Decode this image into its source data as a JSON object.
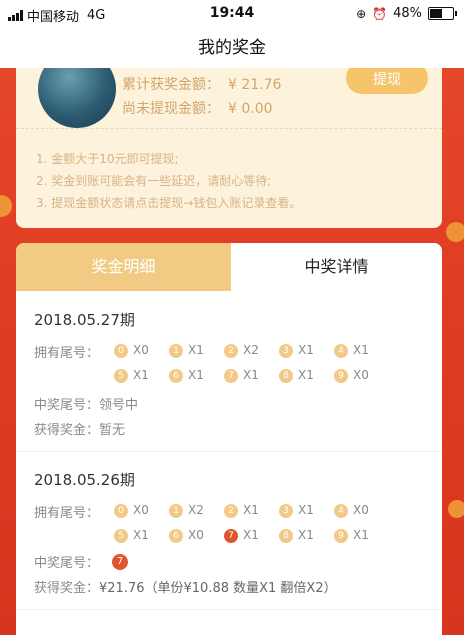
{
  "status_bar": {
    "carrier": "中国移动",
    "network": "4G",
    "time": "19:44",
    "battery": "48%"
  },
  "nav": {
    "title": "我的奖金"
  },
  "summary": {
    "total_label": "累计获奖金额：",
    "total_value": "¥ 21.76",
    "pending_label": "尚未提现金额：",
    "pending_value": "¥ 0.00",
    "withdraw_button": "提现",
    "notes": [
      "1. 金额大于10元即可提现;",
      "2. 奖金到账可能会有一些延迟，请耐心等待;",
      "3. 提现金额状态请点击提现→钱包入账记录查看。"
    ]
  },
  "tabs": [
    {
      "label": "奖金明细",
      "active": false
    },
    {
      "label": "中奖详情",
      "active": true
    }
  ],
  "records": [
    {
      "period": "2018.05.27期",
      "tails_label": "拥有尾号：",
      "tails": [
        {
          "digit": "0",
          "mult": "X0"
        },
        {
          "digit": "1",
          "mult": "X1"
        },
        {
          "digit": "2",
          "mult": "X2"
        },
        {
          "digit": "3",
          "mult": "X1"
        },
        {
          "digit": "4",
          "mult": "X1"
        },
        {
          "digit": "5",
          "mult": "X1"
        },
        {
          "digit": "6",
          "mult": "X1"
        },
        {
          "digit": "7",
          "mult": "X1"
        },
        {
          "digit": "8",
          "mult": "X1"
        },
        {
          "digit": "9",
          "mult": "X0"
        }
      ],
      "win_tail_label": "中奖尾号：",
      "win_tail": "领号中",
      "prize_label": "获得奖金：",
      "prize": "暂无"
    },
    {
      "period": "2018.05.26期",
      "tails_label": "拥有尾号：",
      "tails": [
        {
          "digit": "0",
          "mult": "X0"
        },
        {
          "digit": "1",
          "mult": "X2"
        },
        {
          "digit": "2",
          "mult": "X1"
        },
        {
          "digit": "3",
          "mult": "X1"
        },
        {
          "digit": "4",
          "mult": "X0"
        },
        {
          "digit": "5",
          "mult": "X1"
        },
        {
          "digit": "6",
          "mult": "X0"
        },
        {
          "digit": "7",
          "mult": "X1",
          "hit": true
        },
        {
          "digit": "8",
          "mult": "X1"
        },
        {
          "digit": "9",
          "mult": "X1"
        }
      ],
      "win_tail_label": "中奖尾号：",
      "win_tail": "7",
      "prize_label": "获得奖金：",
      "prize": "¥21.76（单份¥10.88 数量X1 翻倍X2）"
    }
  ],
  "colors": {
    "red_bg": "#e5472a",
    "gold": "#f1cb83",
    "ball": "#f3c987",
    "ball_hit": "#e0542f",
    "cream": "#fdf2dc"
  }
}
